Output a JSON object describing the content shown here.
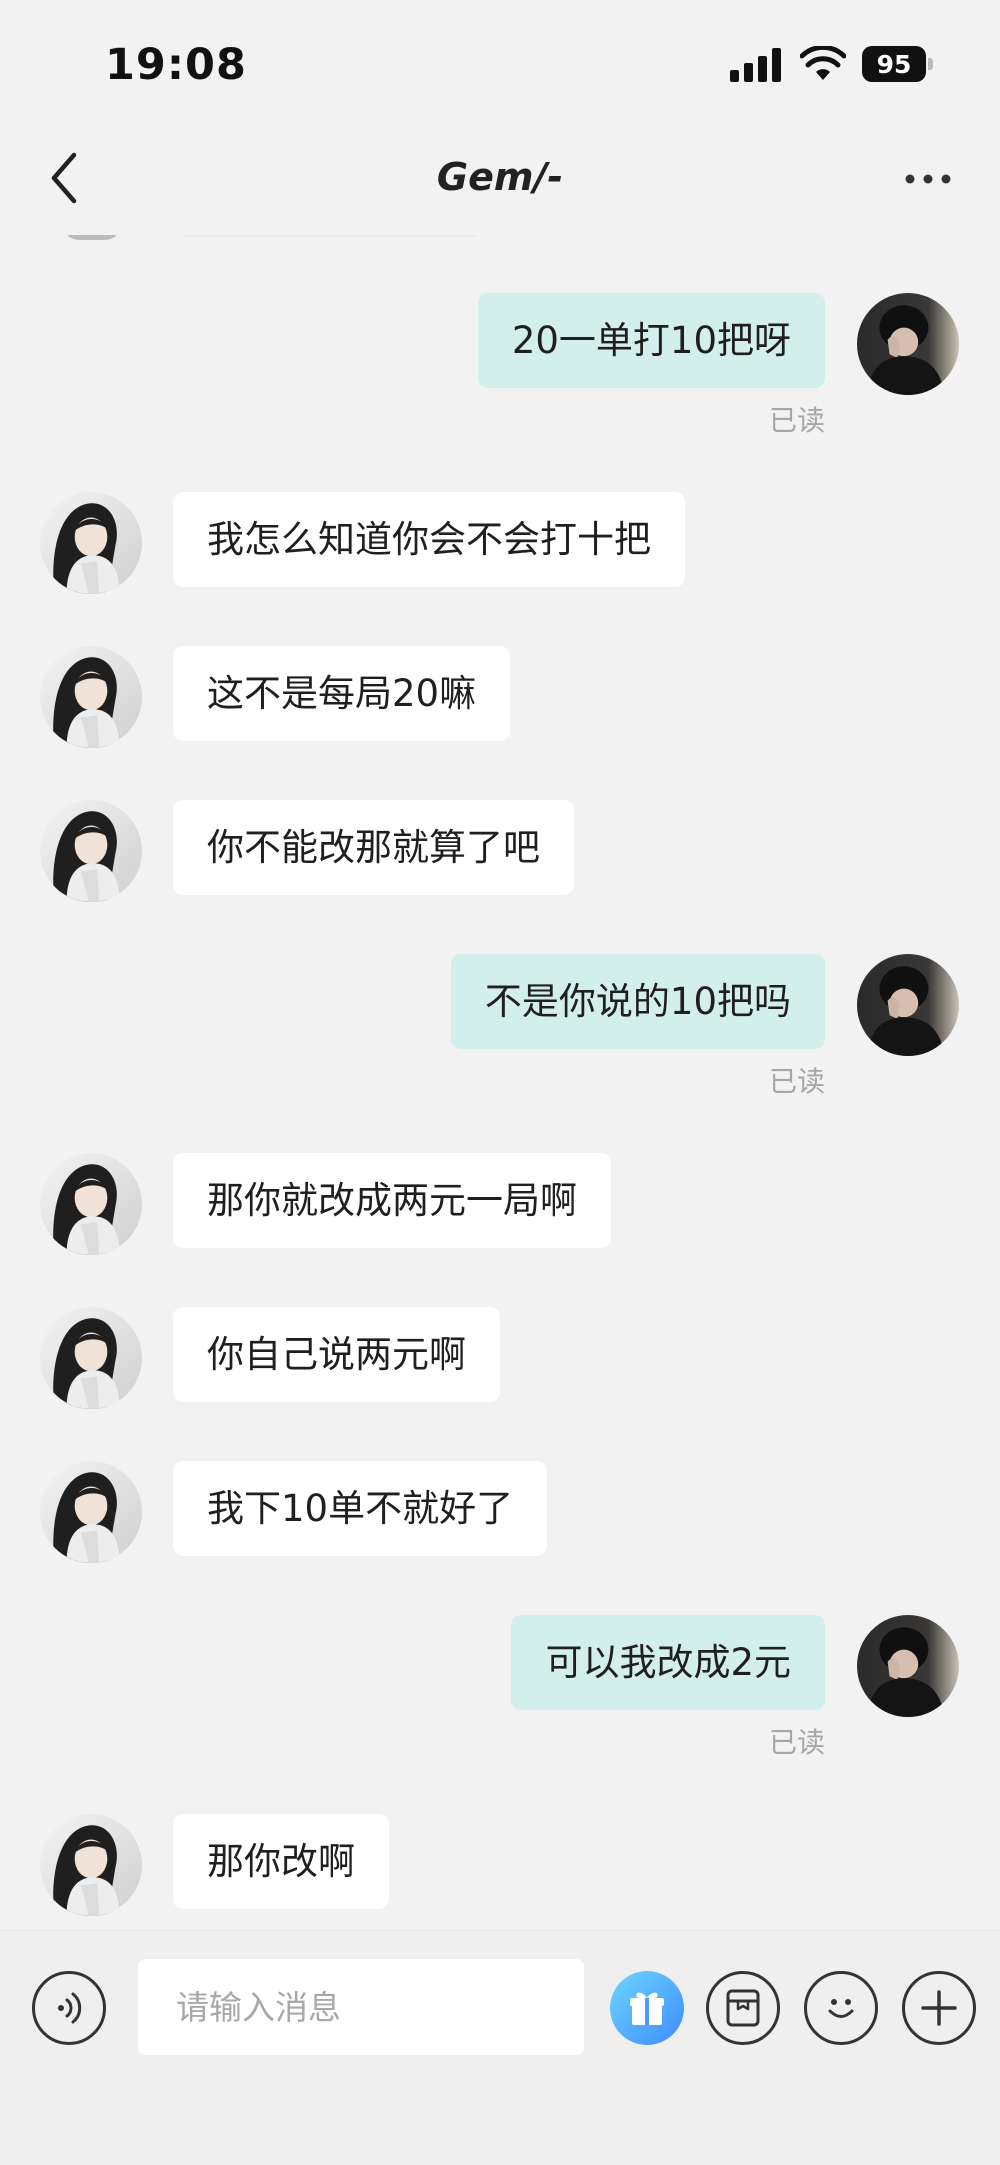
{
  "status_bar": {
    "time": "19:08",
    "battery": "95"
  },
  "header": {
    "title": "Gem/-"
  },
  "messages": [
    {
      "side": "right",
      "text": "20一单打10把呀",
      "status": "已读"
    },
    {
      "side": "left",
      "text": "我怎么知道你会不会打十把"
    },
    {
      "side": "left",
      "text": "这不是每局20嘛"
    },
    {
      "side": "left",
      "text": "你不能改那就算了吧"
    },
    {
      "side": "right",
      "text": "不是你说的10把吗",
      "status": "已读"
    },
    {
      "side": "left",
      "text": "那你就改成两元一局啊"
    },
    {
      "side": "left",
      "text": "你自己说两元啊"
    },
    {
      "side": "left",
      "text": "我下10单不就好了"
    },
    {
      "side": "right",
      "text": "可以我改成2元",
      "status": "已读"
    },
    {
      "side": "left",
      "text": "那你改啊"
    }
  ],
  "input_bar": {
    "placeholder": "请输入消息"
  },
  "icons": {
    "voice": "voice-icon",
    "gift": "gift-icon",
    "card": "card-icon",
    "emoji": "emoji-icon",
    "plus": "plus-icon"
  },
  "colors": {
    "background": "#f2f2f2",
    "own_bubble": "#d3efec",
    "other_bubble": "#ffffff",
    "gift_gradient_start": "#6fd6ff",
    "gift_gradient_end": "#3d8bff"
  }
}
